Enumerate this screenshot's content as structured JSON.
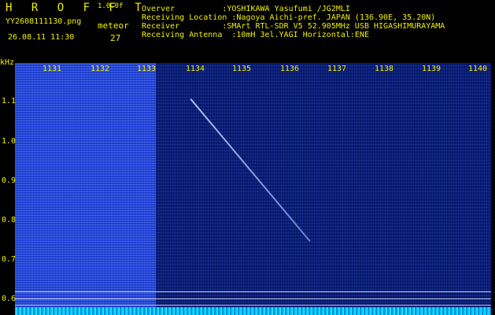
{
  "header": {
    "app_title": "H R O F F T",
    "version": "1.0.0f",
    "filename": "YY2608111130.png",
    "meteor_label": "meteor",
    "datetime": "26.08.11 11:30",
    "meteor_count": "27"
  },
  "info": {
    "observer": "Overver          :YOSHIKAWA Yasufumi /JG2MLI",
    "location": "Receiving Location :Nagoya Aichi-pref. JAPAN (136.90E, 35.20N)",
    "receiver": "Receiver         :SMArt RTL-SDR V5 52.905MHz USB HIGASHIMURAYAMA",
    "antenna": "Receiving Antenna  :10mH 3el.YAGI Horizontal:ENE"
  },
  "axis": {
    "y_unit": "kHz",
    "x_ticks": [
      "1131",
      "1132",
      "1133",
      "1134",
      "1135",
      "1136",
      "1137",
      "1138",
      "1139",
      "1140"
    ],
    "y_ticks": [
      "1.1",
      "1.0",
      "0.9",
      "0.8",
      "0.7",
      "0.6"
    ]
  }
}
